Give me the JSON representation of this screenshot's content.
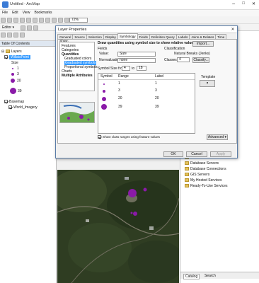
{
  "window": {
    "title": "Untitled - ArcMap"
  },
  "menubar": [
    "File",
    "Edit",
    "View",
    "Bookmarks"
  ],
  "toolbar": {
    "zoom_value": "72%",
    "editor_label": "Editor ▾"
  },
  "toc": {
    "title": "Table Of Contents",
    "layers_label": "Layers",
    "layer_name": "WillaisPoint",
    "field_label": "Size",
    "legend": [
      {
        "label": "1"
      },
      {
        "label": "3"
      },
      {
        "label": "20"
      },
      {
        "label": "39"
      }
    ],
    "basemap_label": "Basemap",
    "imagery_label": "World_Imagery"
  },
  "dialog": {
    "title": "Layer Properties",
    "close": "✕",
    "tabs": [
      "General",
      "Source",
      "Selection",
      "Display",
      "Symbology",
      "Fields",
      "Definition Query",
      "Labels",
      "Joins & Relates",
      "Time",
      "HTML Popup"
    ],
    "active_tab": "Symbology",
    "show_label": "Show:",
    "show_items": [
      "Features",
      "Categories",
      "Quantities",
      "Graduated colors",
      "Graduated symbols",
      "Proportional symbols",
      "Charts",
      "Multiple Attributes"
    ],
    "heading": "Draw quantities using symbol size to show relative values.",
    "import_label": "Import...",
    "fields_label": "Fields",
    "value_label": "Value:",
    "value_field": "Size",
    "normalization_label": "Normalization:",
    "normalization_value": "none",
    "classification_label": "Classification",
    "method_label": "Natural Breaks (Jenks)",
    "classes_label": "Classes:",
    "classes_value": "4",
    "classify_label": "Classify...",
    "symbol_size_label": "Symbol Size from:",
    "size_from": "4",
    "to_label": "to",
    "size_to": "18",
    "template_label": "Template",
    "table_headers": [
      "Symbol",
      "Range",
      "Label"
    ],
    "rows": [
      {
        "range": "1",
        "label": "1"
      },
      {
        "range": "3",
        "label": "3"
      },
      {
        "range": "20",
        "label": "20"
      },
      {
        "range": "39",
        "label": "39"
      }
    ],
    "show_ranges_label": "Show class ranges using feature values",
    "advanced_label": "Advanced ▾",
    "ok": "OK",
    "cancel": "Cancel",
    "apply": "Apply"
  },
  "catalog": {
    "items": [
      "Toolboxes",
      "Database Servers",
      "Database Connections",
      "GIS Servers",
      "My Hosted Services",
      "Ready-To-Use Services"
    ],
    "tab_catalog": "Catalog",
    "tab_search": "Search"
  },
  "colors": {
    "symbol": "#8a1aa8",
    "selection": "#3399ff",
    "dialog_border": "#5a7da8"
  }
}
